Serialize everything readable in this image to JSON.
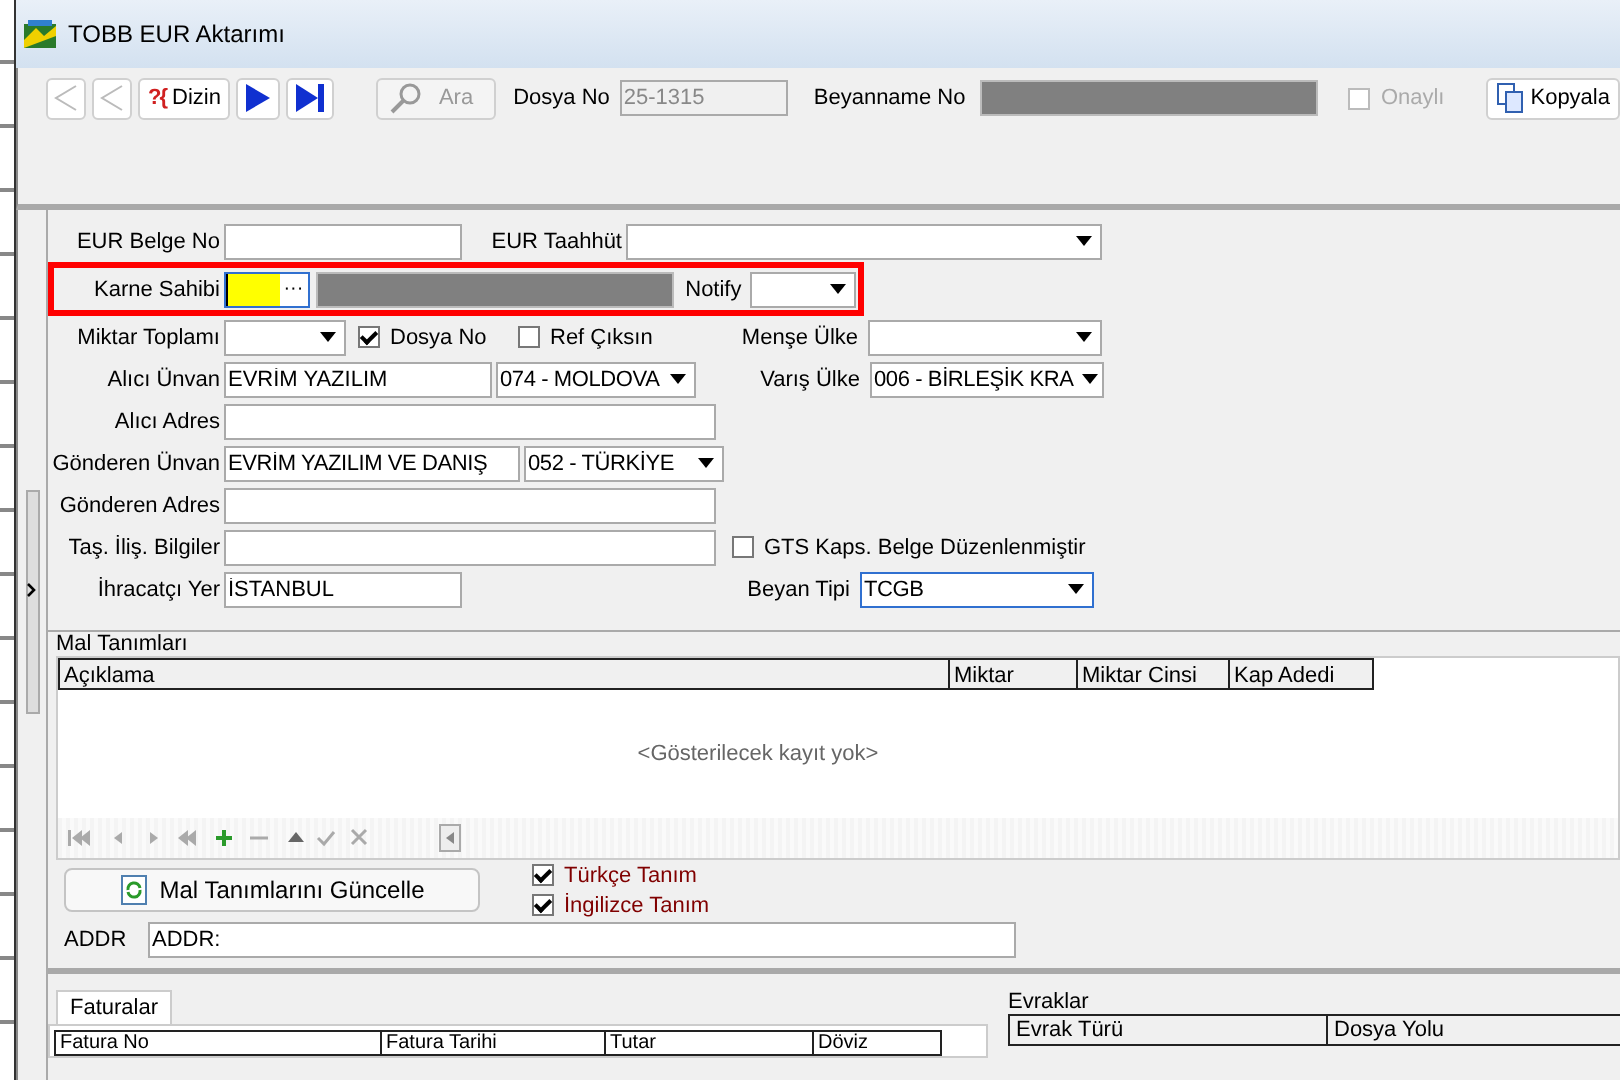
{
  "window": {
    "title": "TOBB EUR Aktarımı"
  },
  "toolbar": {
    "dizin_icon": "?{",
    "dizin": "Dizin",
    "ara": "Ara",
    "dosya_no": {
      "label": "Dosya No",
      "value": "25-1315"
    },
    "beyanname_no": {
      "label": "Beyanname No"
    },
    "onayli": {
      "label": "Onaylı",
      "checked": false
    },
    "kopyala": "Kopyala"
  },
  "form": {
    "eur_belge_no": {
      "label": "EUR Belge No"
    },
    "eur_taahhut": {
      "label": "EUR Taahhüt"
    },
    "karne_sahibi": {
      "label": "Karne Sahibi",
      "ellipsis": "···"
    },
    "notify": {
      "label": "Notify"
    },
    "miktar_toplami": {
      "label": "Miktar Toplamı"
    },
    "dosya_no_check": {
      "label": "Dosya No",
      "checked": true
    },
    "ref_ciksin": {
      "label": "Ref Çıksın",
      "checked": false
    },
    "mense_ulke": {
      "label": "Menşe Ülke"
    },
    "alici_unvan": {
      "label": "Alıcı Ünvan",
      "value": "EVRİM YAZILIM",
      "country": "074 - MOLDOVA"
    },
    "varis_ulke": {
      "label": "Varış Ülke",
      "value": "006 - BİRLEŞİK KRA"
    },
    "alici_adres": {
      "label": "Alıcı Adres"
    },
    "gonderen_unvan": {
      "label": "Gönderen Ünvan",
      "value": "EVRİM YAZILIM VE DANIŞ",
      "country": "052 - TÜRKİYE"
    },
    "gonderen_adres": {
      "label": "Gönderen Adres"
    },
    "tas_ilis": {
      "label": "Taş. İliş. Bilgiler"
    },
    "gts": {
      "label": "GTS Kaps. Belge Düzenlenmiştir",
      "checked": false
    },
    "ihracatci_yer": {
      "label": "İhracatçı Yer",
      "value": "İSTANBUL"
    },
    "beyan_tipi": {
      "label": "Beyan Tipi",
      "value": "TCGB"
    }
  },
  "mal": {
    "title": "Mal Tanımları",
    "columns": [
      "Açıklama",
      "Miktar",
      "Miktar Cinsi",
      "Kap Adedi"
    ],
    "empty": "<Gösterilecek kayıt yok>",
    "update_button": "Mal Tanımlarını Güncelle",
    "checks": [
      {
        "label": "Türkçe Tanım",
        "checked": true
      },
      {
        "label": "İngilizce Tanım",
        "checked": true
      }
    ],
    "addr": {
      "label": "ADDR",
      "value": "ADDR:"
    }
  },
  "faturalar": {
    "tab": "Faturalar",
    "columns": [
      "Fatura No",
      "Fatura Tarihi",
      "Tutar",
      "Döviz"
    ]
  },
  "evraklar": {
    "title": "Evraklar",
    "columns": [
      "Evrak Türü",
      "Dosya Yolu"
    ]
  }
}
